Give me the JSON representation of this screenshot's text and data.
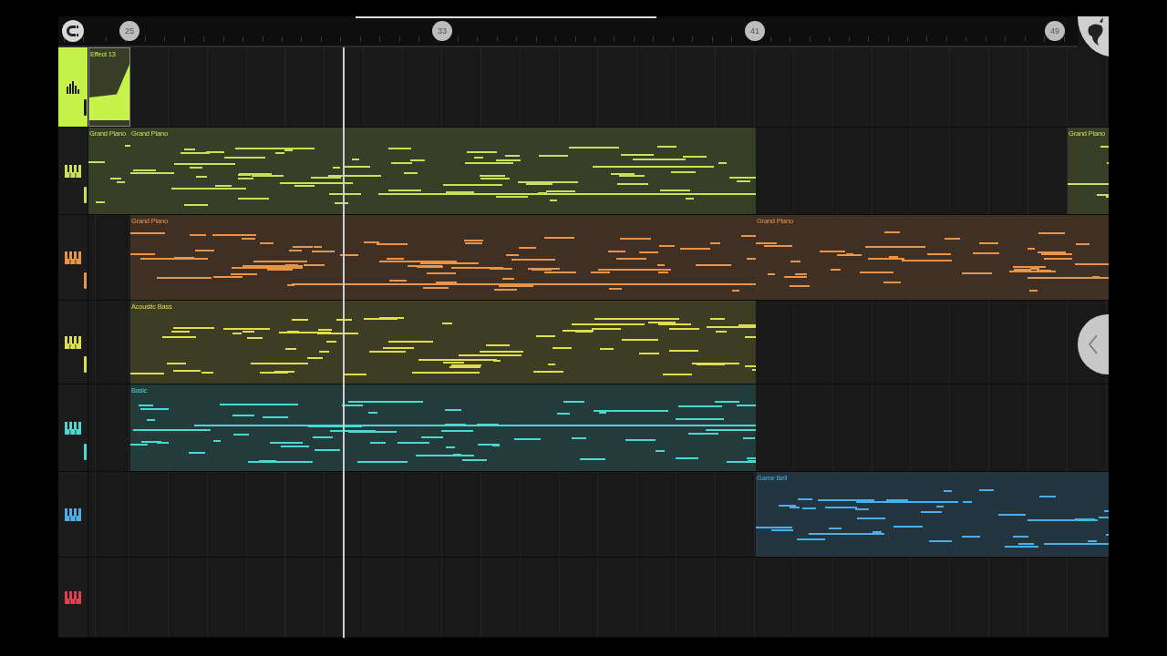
{
  "ruler": {
    "markers": [
      "25",
      "33",
      "41",
      "49"
    ]
  },
  "tracks": [
    {
      "kind": "effect",
      "color": "#c6f24a",
      "selected": true,
      "meter": true,
      "clips": [
        {
          "kind": "automation",
          "label": "Effect 13"
        }
      ]
    },
    {
      "kind": "instrument",
      "color": "#c8e05a",
      "selected": false,
      "meter": true,
      "clips": [
        {
          "kind": "notes",
          "label": "Grand Piano"
        },
        {
          "kind": "notes",
          "label": "Grand Piano"
        },
        {
          "kind": "notes",
          "label": "Grand Piano"
        }
      ]
    },
    {
      "kind": "instrument",
      "color": "#e8954a",
      "selected": false,
      "meter": true,
      "clips": [
        {
          "kind": "notes",
          "label": "Grand Piano"
        },
        {
          "kind": "notes",
          "label": "Grand Piano"
        }
      ]
    },
    {
      "kind": "instrument",
      "color": "#dede4a",
      "selected": false,
      "meter": true,
      "clips": [
        {
          "kind": "notes",
          "label": "Acoustic Bass"
        }
      ]
    },
    {
      "kind": "instrument",
      "color": "#4ad8d0",
      "selected": false,
      "meter": true,
      "clips": [
        {
          "kind": "notes",
          "label": "Basic"
        }
      ]
    },
    {
      "kind": "instrument",
      "color": "#4ab0e8",
      "selected": false,
      "meter": false,
      "clips": [
        {
          "kind": "notes",
          "label": "Game Bell"
        }
      ]
    },
    {
      "kind": "instrument",
      "color": "#e04050",
      "selected": false,
      "meter": false
    }
  ]
}
